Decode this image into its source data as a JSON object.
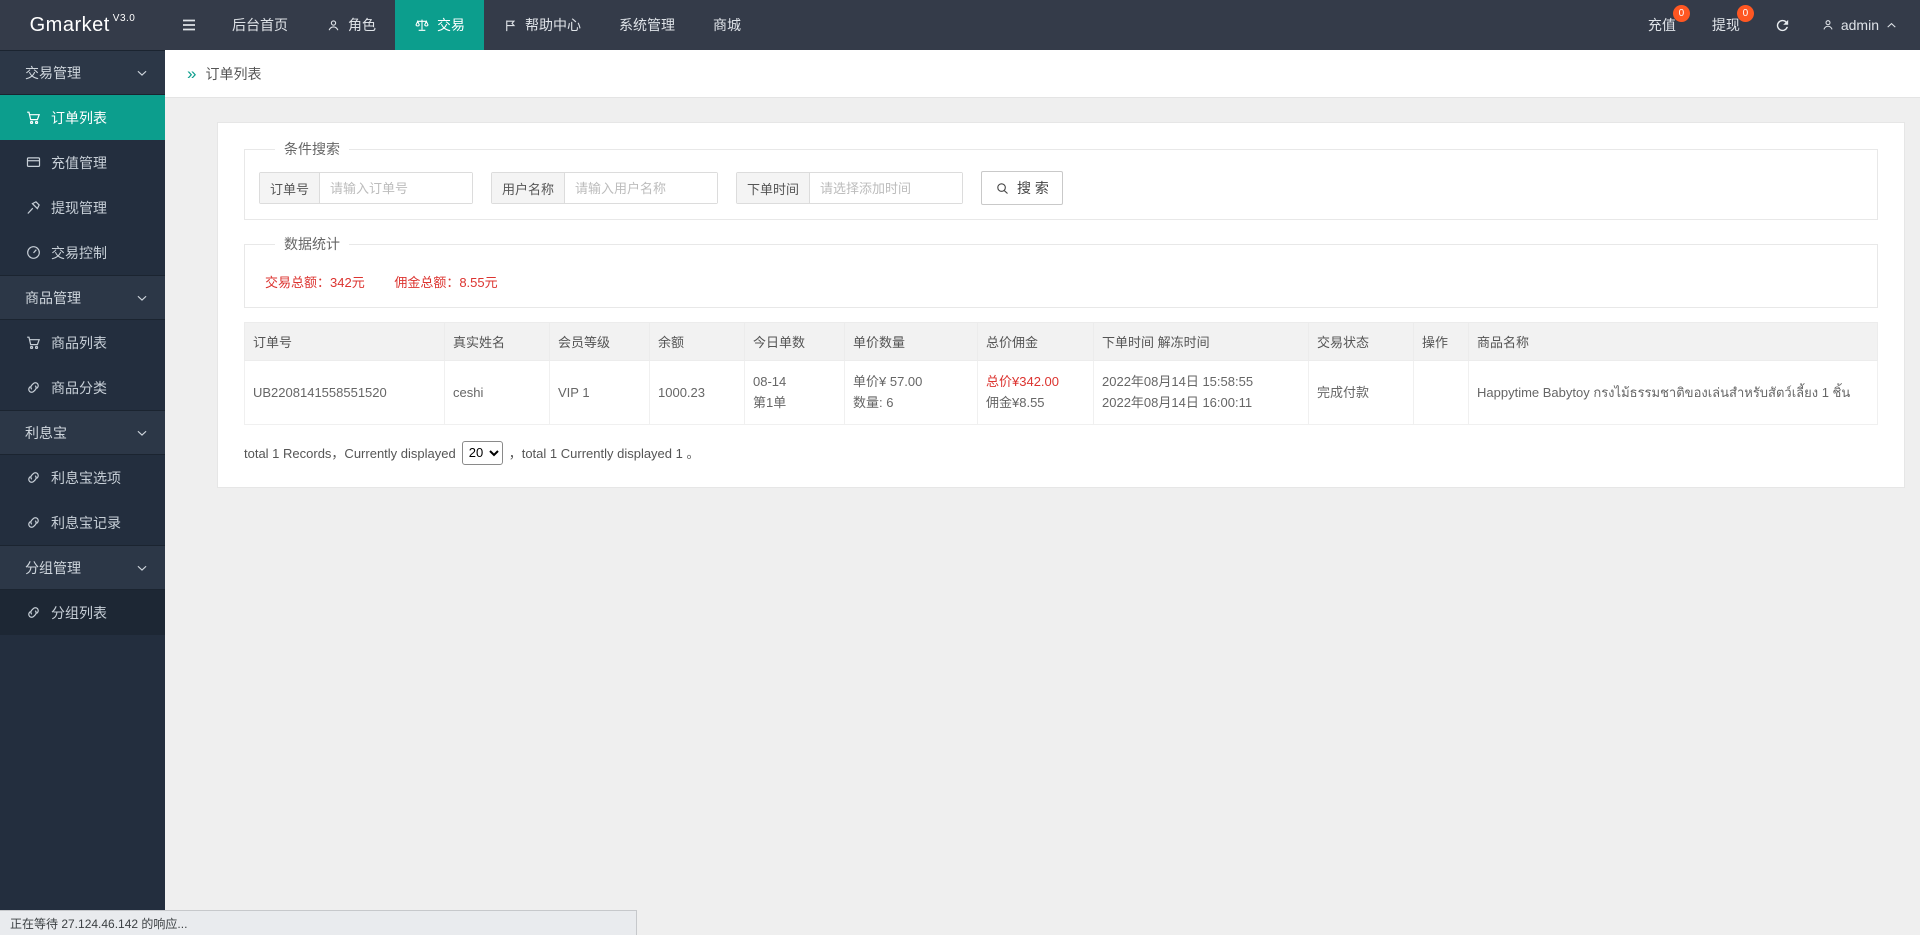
{
  "navbar": {
    "brand": "Gmarket",
    "version": "V3.0",
    "menu": [
      {
        "label": "后台首页"
      },
      {
        "label": "角色",
        "icon": "person"
      },
      {
        "label": "交易",
        "icon": "scales",
        "active": true
      },
      {
        "label": "帮助中心",
        "icon": "flag"
      },
      {
        "label": "系统管理"
      },
      {
        "label": "商城"
      }
    ],
    "recharge": {
      "label": "充值",
      "badge": "0"
    },
    "withdraw": {
      "label": "提现",
      "badge": "0"
    },
    "user": {
      "name": "admin"
    }
  },
  "sidebar": {
    "items": [
      {
        "label": "交易管理",
        "type": "header"
      },
      {
        "label": "订单列表",
        "type": "item",
        "icon": "cart",
        "active": true
      },
      {
        "label": "充值管理",
        "type": "item",
        "icon": "card"
      },
      {
        "label": "提现管理",
        "type": "item",
        "icon": "hammer"
      },
      {
        "label": "交易控制",
        "type": "item",
        "icon": "gauge"
      },
      {
        "label": "商品管理",
        "type": "header"
      },
      {
        "label": "商品列表",
        "type": "item",
        "icon": "cart"
      },
      {
        "label": "商品分类",
        "type": "item",
        "icon": "link"
      },
      {
        "label": "利息宝",
        "type": "header"
      },
      {
        "label": "利息宝选项",
        "type": "item",
        "icon": "link"
      },
      {
        "label": "利息宝记录",
        "type": "item",
        "icon": "link"
      },
      {
        "label": "分组管理",
        "type": "header"
      },
      {
        "label": "分组列表",
        "type": "item",
        "icon": "link"
      }
    ]
  },
  "breadcrumb": {
    "title": "订单列表"
  },
  "search": {
    "legend": "条件搜索",
    "fields": [
      {
        "label": "订单号",
        "placeholder": "请输入订单号"
      },
      {
        "label": "用户名称",
        "placeholder": "请输入用户名称"
      },
      {
        "label": "下单时间",
        "placeholder": "请选择添加时间"
      }
    ],
    "button_label": "搜 索"
  },
  "stats": {
    "legend": "数据统计",
    "total_trade": "交易总额：342元",
    "total_commission": "佣金总额：8.55元"
  },
  "table": {
    "headers": [
      "订单号",
      "真实姓名",
      "会员等级",
      "余额",
      "今日单数",
      "单价数量",
      "总价佣金",
      "下单时间 解冻时间",
      "交易状态",
      "操作",
      "商品名称"
    ],
    "row": {
      "order_no": "UB2208141558551520",
      "real_name": "ceshi",
      "vip_level": "VIP 1",
      "balance": "1000.23",
      "today_date": "08-14",
      "today_order": "第1单",
      "unit_price": "单价¥ 57.00",
      "quantity": "数量: 6",
      "total_price": "总价¥342.00",
      "commission": "佣金¥8.55",
      "order_time": "2022年08月14日 15:58:55",
      "unfreeze_time": "2022年08月14日 16:00:11",
      "status": "完成付款",
      "action": "",
      "product": "Happytime Babytoy กรงไม้ธรรมชาติของเล่นสำหรับสัตว์เลี้ยง 1 ชิ้น"
    }
  },
  "pagination": {
    "prefix": "total 1 Records，Currently displayed",
    "page_size": "20",
    "suffix": "，total 1 Currently displayed 1 。"
  },
  "browser": {
    "status_text": "正在等待 27.124.46.142 的响应..."
  },
  "colors": {
    "accent": "#0c9e8d",
    "badge": "#ff5722",
    "danger": "#dc3430",
    "navbar": "#343b49",
    "sidebar": "#232e3e"
  }
}
